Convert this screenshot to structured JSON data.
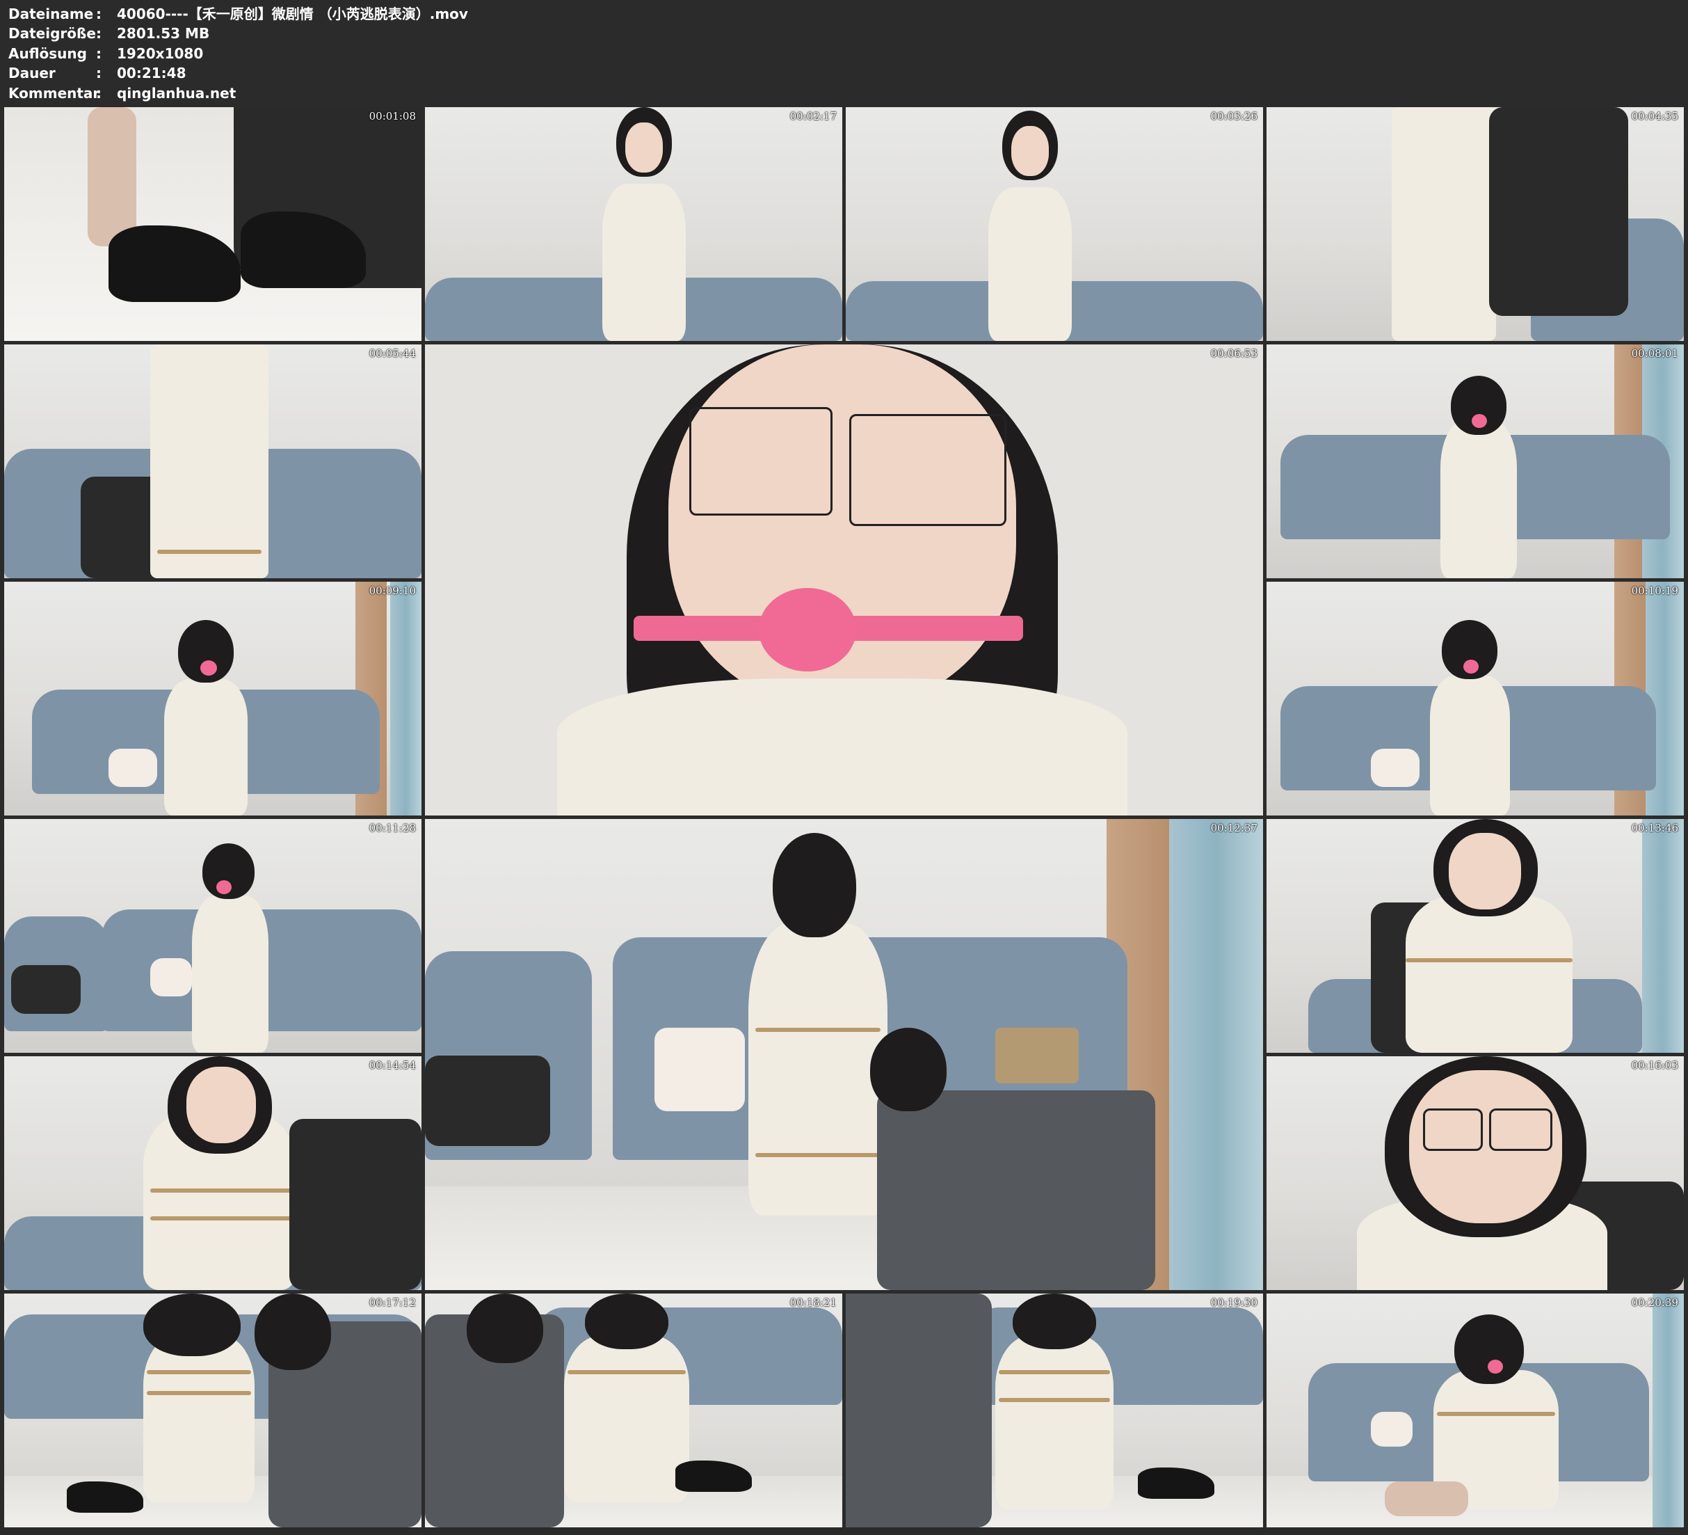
{
  "info": {
    "rows": [
      {
        "key": "Dateiname",
        "value": "40060----【禾一原创】微剧情 （小芮逃脱表演）.mov"
      },
      {
        "key": "Dateigröße",
        "value": "2801.53 MB"
      },
      {
        "key": "Auflösung",
        "value": "1920x1080"
      },
      {
        "key": "Dauer",
        "value": "00:21:48"
      },
      {
        "key": "Kommentar",
        "value": "qinglanhua.net"
      }
    ],
    "separator": ":"
  },
  "thumbnails": [
    {
      "timestamp": "00:01:08"
    },
    {
      "timestamp": "00:02:17"
    },
    {
      "timestamp": "00:03:26"
    },
    {
      "timestamp": "00:04:35"
    },
    {
      "timestamp": "00:05:44"
    },
    {
      "timestamp": "00:06:53"
    },
    {
      "timestamp": "00:08:01"
    },
    {
      "timestamp": "00:09:10"
    },
    {
      "timestamp": "00:10:19"
    },
    {
      "timestamp": "00:11:28"
    },
    {
      "timestamp": "00:12:37"
    },
    {
      "timestamp": "00:13:46"
    },
    {
      "timestamp": "00:14:54"
    },
    {
      "timestamp": "00:16:03"
    },
    {
      "timestamp": "00:17:12"
    },
    {
      "timestamp": "00:18:21"
    },
    {
      "timestamp": "00:19:30"
    },
    {
      "timestamp": "00:20:39"
    }
  ]
}
